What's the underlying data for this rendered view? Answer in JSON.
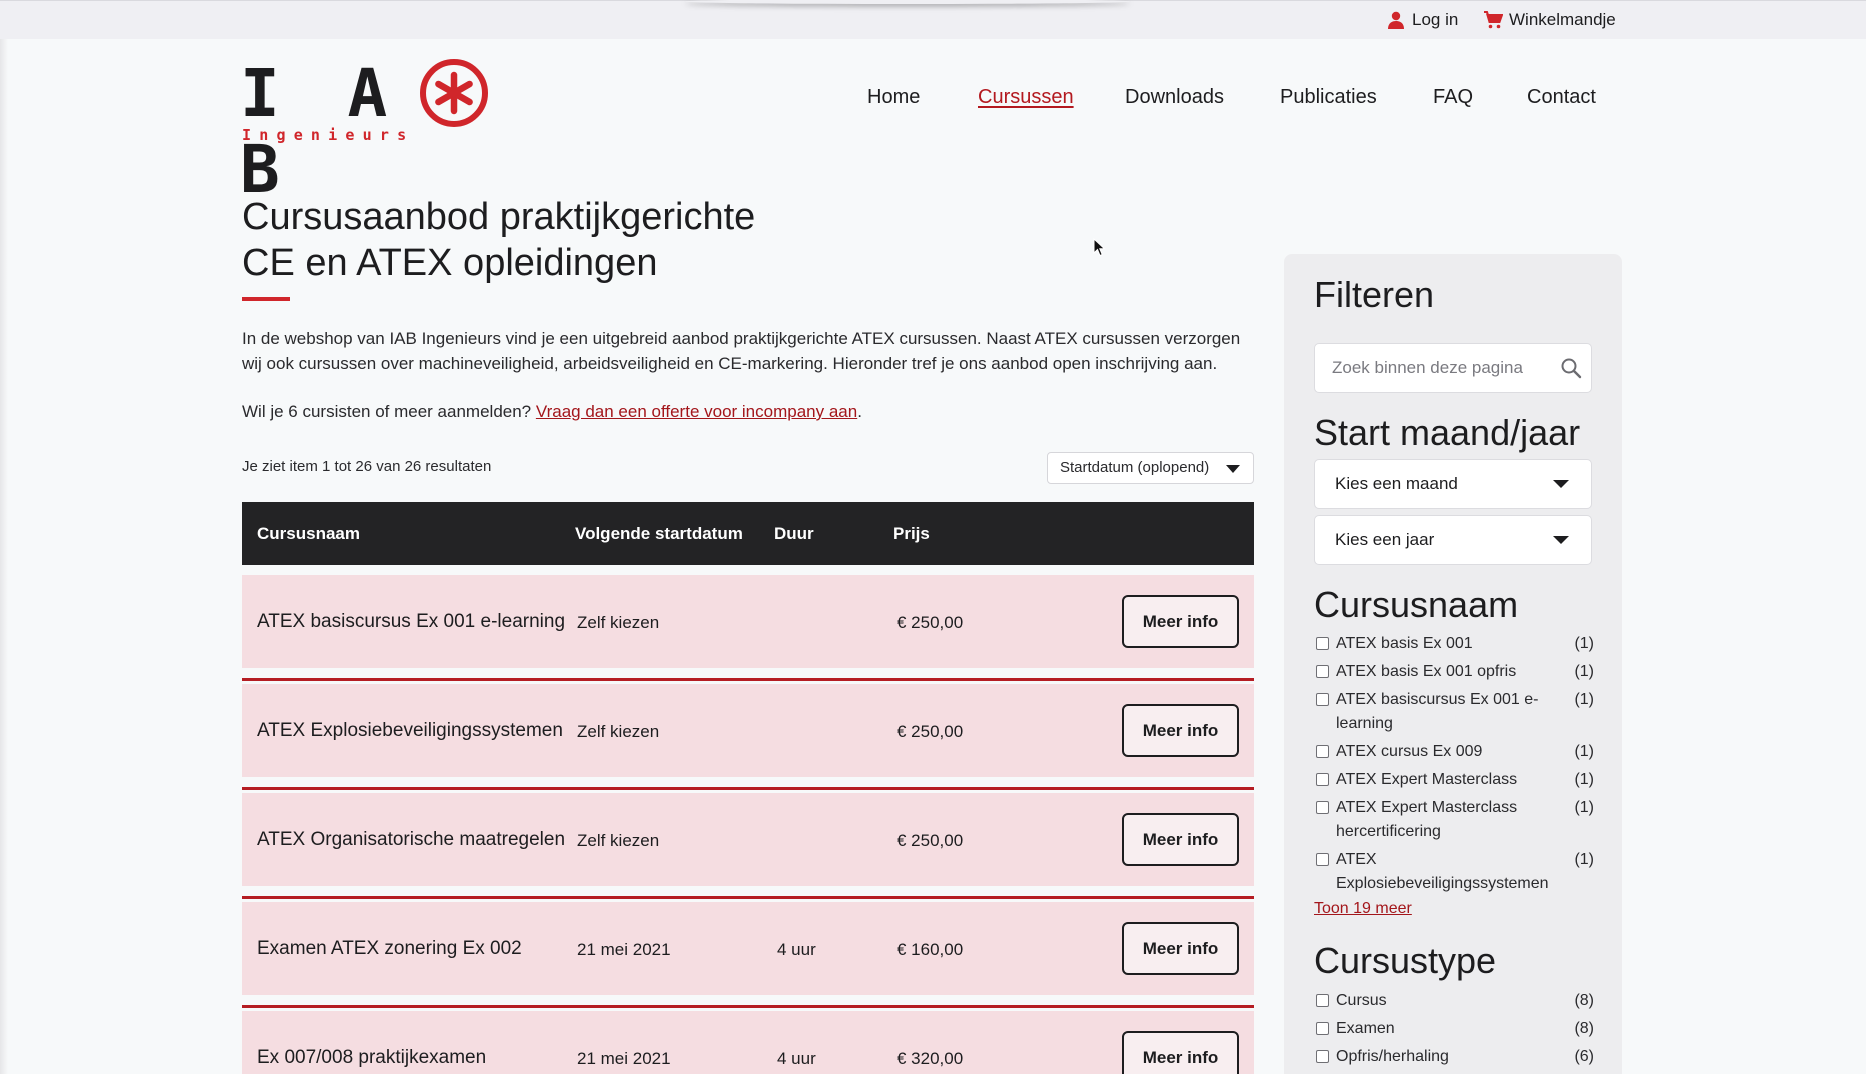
{
  "topbar": {
    "login_label": "Log in",
    "cart_label": "Winkelmandje"
  },
  "logo": {
    "letters": "I A B",
    "subtitle": "Ingenieurs",
    "accent_color": "#d0262b"
  },
  "nav": {
    "items": [
      {
        "label": "Home",
        "active": false
      },
      {
        "label": "Cursussen",
        "active": true
      },
      {
        "label": "Downloads",
        "active": false
      },
      {
        "label": "Publicaties",
        "active": false
      },
      {
        "label": "FAQ",
        "active": false
      },
      {
        "label": "Contact",
        "active": false
      }
    ]
  },
  "main": {
    "title_line1": "Cursusaanbod praktijkgerichte",
    "title_line2": "CE en ATEX opleidingen",
    "intro": "In de webshop van IAB Ingenieurs vind je een uitgebreid aanbod praktijkgerichte ATEX cursussen. Naast ATEX cursussen verzorgen wij ook cursussen over machineveiligheid, arbeidsveiligheid en CE-markering. Hieronder tref je ons aanbod open inschrijving aan.",
    "incompany_prefix": "Wil je 6 cursisten of meer aanmelden?",
    "incompany_link": "Vraag dan een offerte voor incompany aan",
    "incompany_suffix": ".",
    "result_count": "Je ziet item 1 tot 26 van 26 resultaten",
    "sort_selected": "Startdatum (oplopend)"
  },
  "table": {
    "headers": [
      "Cursusnaam",
      "Volgende startdatum",
      "Duur",
      "Prijs"
    ],
    "button_label": "Meer info",
    "rows": [
      {
        "name": "ATEX basiscursus Ex 001 e-learning",
        "start": "Zelf kiezen",
        "duration": "",
        "price": "€ 250,00"
      },
      {
        "name": "ATEX Explosiebeveiligingssystemen",
        "start": "Zelf kiezen",
        "duration": "",
        "price": "€ 250,00"
      },
      {
        "name": "ATEX Organisatorische maatregelen",
        "start": "Zelf kiezen",
        "duration": "",
        "price": "€ 250,00"
      },
      {
        "name": "Examen ATEX zonering Ex 002",
        "start": "21 mei 2021",
        "duration": "4 uur",
        "price": "€ 160,00"
      },
      {
        "name": "Ex 007/008 praktijkexamen",
        "start": "21 mei 2021",
        "duration": "4 uur",
        "price": "€ 320,00"
      }
    ]
  },
  "sidebar": {
    "title": "Filteren",
    "search_placeholder": "Zoek binnen deze pagina",
    "start_heading": "Start maand/jaar",
    "month_select": "Kies een maand",
    "year_select": "Kies een jaar",
    "course_heading": "Cursusnaam",
    "course_items": [
      {
        "label": "ATEX basis Ex 001",
        "count": "(1)"
      },
      {
        "label": "ATEX basis Ex 001 opfris",
        "count": "(1)"
      },
      {
        "label": "ATEX basiscursus Ex 001 e-learning",
        "count": "(1)"
      },
      {
        "label": "ATEX cursus Ex 009",
        "count": "(1)"
      },
      {
        "label": "ATEX Expert Masterclass",
        "count": "(1)"
      },
      {
        "label": "ATEX Expert Masterclass hercertificering",
        "count": "(1)"
      },
      {
        "label": "ATEX Explosiebeveiligingssystemen",
        "count": "(1)"
      }
    ],
    "more_link": "Toon 19 meer",
    "type_heading": "Cursustype",
    "type_items": [
      {
        "label": "Cursus",
        "count": "(8)"
      },
      {
        "label": "Examen",
        "count": "(8)"
      },
      {
        "label": "Opfris/herhaling",
        "count": "(6)"
      }
    ]
  }
}
